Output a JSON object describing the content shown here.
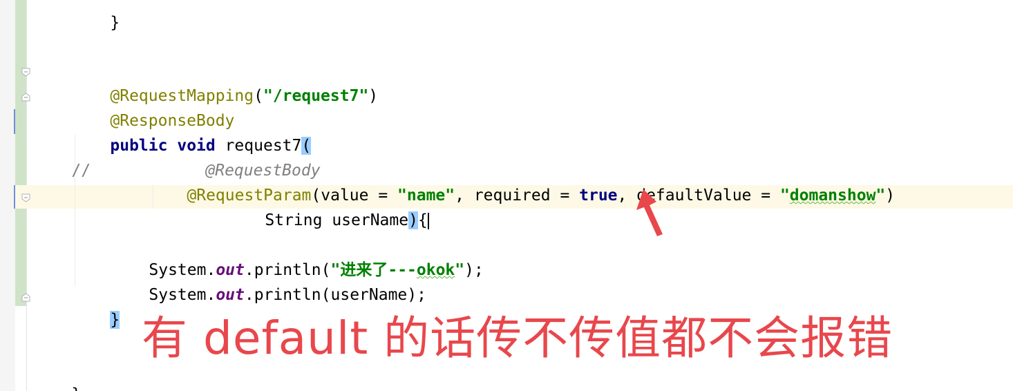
{
  "editor": {
    "lines": {
      "closing_brace_top": "}",
      "annotation_mapping": "@RequestMapping",
      "mapping_open_paren": "(",
      "mapping_path": "\"/request7\"",
      "mapping_close_paren": ")",
      "annotation_response_body": "@ResponseBody",
      "kw_public": "public",
      "kw_void": "void",
      "method_name": " request7",
      "method_open_paren": "(",
      "comment_marker": "//",
      "commented_annotation": "@RequestBody",
      "annotation_request_param": "@RequestParam",
      "param_args_1": "(value = ",
      "param_value_name": "\"name\"",
      "param_args_2": ", required = ",
      "param_kw_true": "true",
      "param_args_3": ", defaultValue = ",
      "param_default_open": "\"",
      "param_default_word": "domanshow",
      "param_default_close": "\"",
      "param_args_4": ")",
      "param_type_and_name": "String userName",
      "param_close_paren": ")",
      "param_open_brace": "{",
      "println1_prefix": "System.",
      "println1_field": "out",
      "println1_method": ".println(",
      "println1_string_open": "\"进来了---",
      "println1_string_word": "okok",
      "println1_string_close": "\"",
      "println1_suffix": ");",
      "println2_prefix": "System.",
      "println2_field": "out",
      "println2_suffix": ".println(userName);",
      "method_closing_brace": "}",
      "class_closing_brace": "}"
    }
  },
  "annotation_overlay": {
    "text": "有 default 的话传不传值都不会报错",
    "color": "#e8474c"
  },
  "colors": {
    "annotation": "#808000",
    "keyword": "#000080",
    "string": "#008000",
    "field": "#660e7a",
    "comment": "#808080",
    "brace_highlight": "#99ccff",
    "current_line": "#fdf9e6",
    "arrow": "#e8474c"
  }
}
